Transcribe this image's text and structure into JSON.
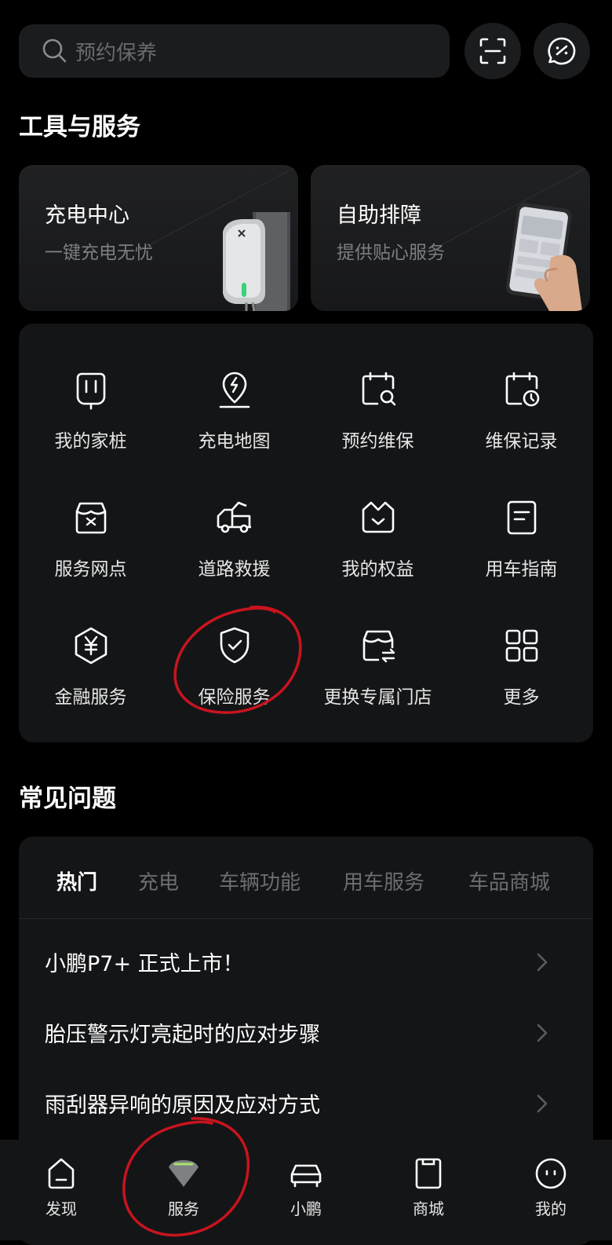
{
  "search": {
    "placeholder": "预约保养",
    "icons": [
      "search-icon",
      "scan-icon",
      "message-icon"
    ]
  },
  "tools": {
    "title": "工具与服务",
    "cards": [
      {
        "title": "充电中心",
        "subtitle": "一键充电无忧",
        "image": "wall-charger"
      },
      {
        "title": "自助排障",
        "subtitle": "提供贴心服务",
        "image": "hand-holding-phone"
      }
    ],
    "grid": [
      {
        "label": "我的家桩",
        "icon": "home-charger-icon"
      },
      {
        "label": "充电地图",
        "icon": "charge-map-pin-icon"
      },
      {
        "label": "预约维保",
        "icon": "calendar-search-icon"
      },
      {
        "label": "维保记录",
        "icon": "calendar-clock-icon"
      },
      {
        "label": "服务网点",
        "icon": "service-store-icon"
      },
      {
        "label": "道路救援",
        "icon": "tow-truck-icon"
      },
      {
        "label": "我的权益",
        "icon": "benefits-basket-icon"
      },
      {
        "label": "用车指南",
        "icon": "guide-document-icon"
      },
      {
        "label": "金融服务",
        "icon": "yuan-hexagon-icon"
      },
      {
        "label": "保险服务",
        "icon": "shield-check-icon"
      },
      {
        "label": "更换专属门店",
        "icon": "store-switch-icon"
      },
      {
        "label": "更多",
        "icon": "more-grid-icon"
      }
    ]
  },
  "faq": {
    "title": "常见问题",
    "tabs": [
      "热门",
      "充电",
      "车辆功能",
      "用车服务",
      "车品商城"
    ],
    "active_tab": "热门",
    "questions": [
      "小鹏P7+ 正式上市！",
      "胎压警示灯亮起时的应对步骤",
      "雨刮器异响的原因及应对方式"
    ]
  },
  "nav": {
    "items": [
      {
        "label": "发现",
        "icon": "discover-icon"
      },
      {
        "label": "服务",
        "icon": "service-icon"
      },
      {
        "label": "小鹏",
        "icon": "car-icon"
      },
      {
        "label": "商城",
        "icon": "shop-bag-icon"
      },
      {
        "label": "我的",
        "icon": "profile-face-icon"
      }
    ],
    "active": "服务"
  },
  "colors": {
    "background": "#000000",
    "panel": "#141517",
    "accent_green": "#a6e36b",
    "annotation_red": "#c8141e"
  }
}
